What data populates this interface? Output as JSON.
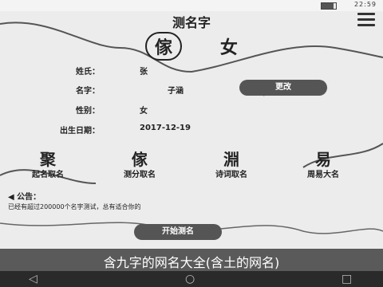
{
  "status_bar": {
    "time": "22:59",
    "battery_percent": 0.85
  },
  "header": {
    "title": "测名字"
  },
  "name_chars": [
    "傢",
    "女"
  ],
  "info": {
    "rows": [
      {
        "label": "姓氏：",
        "value": "张"
      },
      {
        "label": "名字：",
        "value": "子涵"
      },
      {
        "label": "性别：",
        "value": "女"
      },
      {
        "label": "出生日期：",
        "value": "2017-12-19"
      }
    ],
    "change_button": "更改"
  },
  "functions": [
    {
      "icon": "聚",
      "label": "起名取名"
    },
    {
      "icon": "傢",
      "label": "测分取名"
    },
    {
      "icon": "淵",
      "label": "诗词取名"
    },
    {
      "icon": "易",
      "label": "周易大名"
    }
  ],
  "notice": {
    "label": "◀ 公告：",
    "text": "已经有超过200000个名字测试，总有适合你的"
  },
  "primary_button": "开始测名",
  "caption": "含九字的网名大全(含土的网名)",
  "navbar": {
    "back": "◁",
    "home": "○",
    "recent": "□"
  }
}
